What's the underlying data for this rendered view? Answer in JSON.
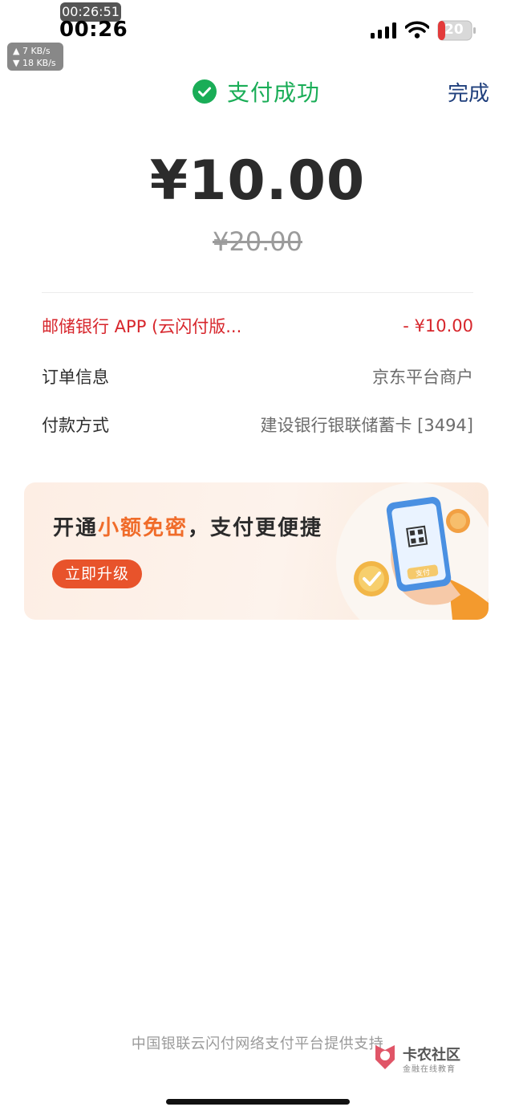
{
  "status_bar": {
    "recording_time": "00:26:51",
    "time": "00:26",
    "net_up": "▲ 7 KB/s",
    "net_down": "▼ 18 KB/s",
    "battery": "20"
  },
  "header": {
    "title": "支付成功",
    "done_label": "完成",
    "success_color": "#1aad57"
  },
  "amount": {
    "paid": "¥10.00",
    "original": "¥20.00"
  },
  "details": {
    "discount_label": "邮储银行 APP (云闪付版...",
    "discount_value": "- ¥10.00",
    "order_label": "订单信息",
    "order_value": "京东平台商户",
    "payment_label": "付款方式",
    "payment_value": "建设银行银联储蓄卡 [3494]"
  },
  "banner": {
    "title_prefix": "开通",
    "title_highlight": "小额免密",
    "title_suffix": "，支付更便捷",
    "button_label": "立即升级",
    "phone_label": "支付"
  },
  "footer": {
    "powered_by": "中国银联云闪付网络支付平台提供支持"
  },
  "watermark": {
    "main": "卡农社区",
    "sub": "金融在线教育"
  },
  "icons": {
    "success": "check-circle-icon",
    "signal": "signal-bars-icon",
    "wifi": "wifi-icon",
    "battery": "battery-icon"
  }
}
